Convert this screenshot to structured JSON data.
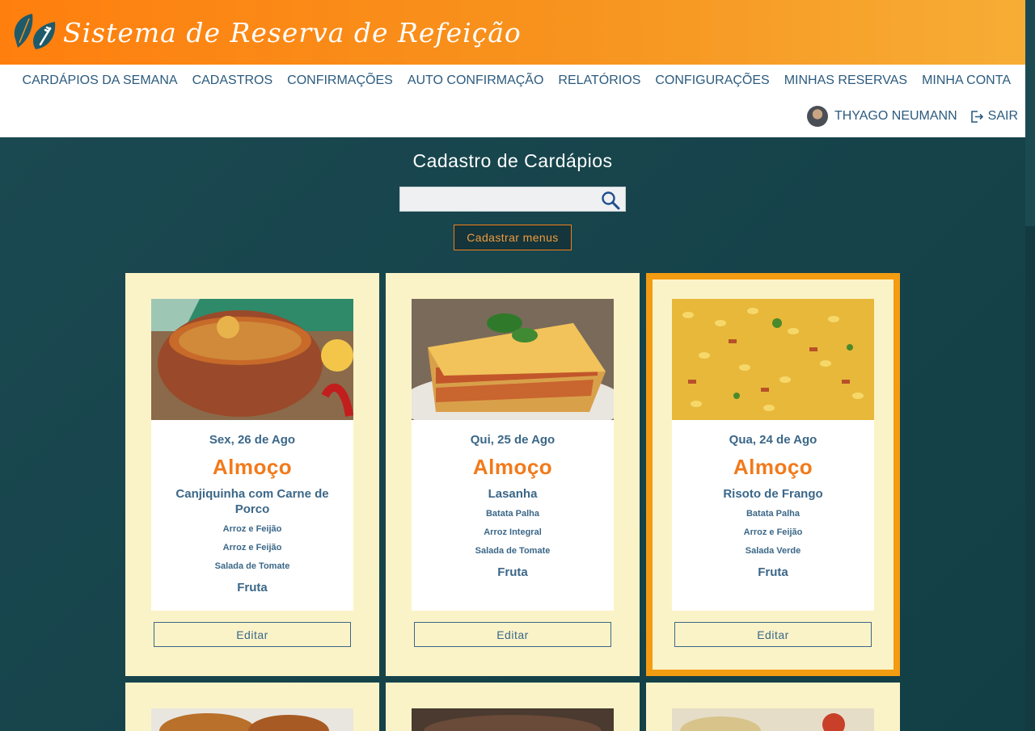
{
  "app": {
    "title": "Sistema de Reserva de Refeição"
  },
  "nav": {
    "items": [
      {
        "label": "CARDÁPIOS DA SEMANA"
      },
      {
        "label": "CADASTROS"
      },
      {
        "label": "CONFIRMAÇÕES"
      },
      {
        "label": "AUTO CONFIRMAÇÃO"
      },
      {
        "label": "RELATÓRIOS"
      },
      {
        "label": "CONFIGURAÇÕES"
      },
      {
        "label": "MINHAS RESERVAS"
      },
      {
        "label": "MINHA CONTA"
      }
    ],
    "user": "THYAGO NEUMANN",
    "logout": "SAIR"
  },
  "page": {
    "title": "Cadastro de Cardápios",
    "search_placeholder": "",
    "add_button": "Cadastrar menus"
  },
  "cards": [
    {
      "date": "Sex, 26 de Ago",
      "meal": "Almoço",
      "main": "Canjiquinha com Carne de Porco",
      "sides": [
        "Arroz e Feijão",
        "Arroz e Feijão",
        "Salada de Tomate"
      ],
      "dessert": "Fruta",
      "edit": "Editar",
      "selected": false
    },
    {
      "date": "Qui, 25 de Ago",
      "meal": "Almoço",
      "main": "Lasanha",
      "sides": [
        "Batata Palha",
        "Arroz Integral",
        "Salada de Tomate"
      ],
      "dessert": "Fruta",
      "edit": "Editar",
      "selected": false
    },
    {
      "date": "Qua, 24 de Ago",
      "meal": "Almoço",
      "main": "Risoto de Frango",
      "sides": [
        "Batata Palha",
        "Arroz e Feijão",
        "Salada Verde"
      ],
      "dessert": "Fruta",
      "edit": "Editar",
      "selected": true
    }
  ],
  "colors": {
    "accent": "#f27a1a",
    "text": "#3b6788",
    "card_bg": "#fbf3c8",
    "selected_border": "#f29c11"
  }
}
